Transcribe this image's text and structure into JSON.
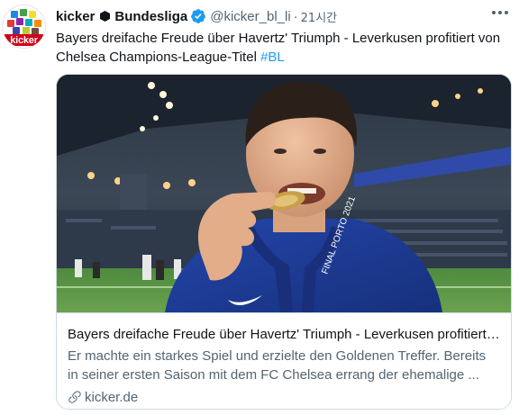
{
  "tweet": {
    "author_name": "kicker",
    "author_name_suffix": "Bundesliga",
    "handle": "@kicker_bl_li",
    "separator": "·",
    "time": "21시간",
    "text": "Bayers dreifache Freude über Havertz' Triumph - Leverkusen profitiert von Chelsea Champions-League-Titel",
    "hashtag": "#BL",
    "avatar_text": "kicker"
  },
  "card": {
    "title": "Bayers dreifache Freude über Havertz' Triumph - Leverkusen profitiert von Chelsea Champions-League-Titel",
    "description": "Er machte ein starkes Spiel und erzielte den Goldenen Treffer. Bereits in seiner ersten Saison mit dem FC Chelsea errang der ehemalige ...",
    "domain": "kicker.de",
    "image_text": "FINAL PORTO 2021"
  },
  "colors": {
    "accent": "#1d9bf0",
    "secondary_text": "#536471",
    "brand_red": "#d0021b",
    "jersey_blue": "#1b3d9a"
  },
  "icons": [
    "avatar",
    "hexagon-icon",
    "verified-badge-icon",
    "more-options-icon",
    "link-icon"
  ]
}
